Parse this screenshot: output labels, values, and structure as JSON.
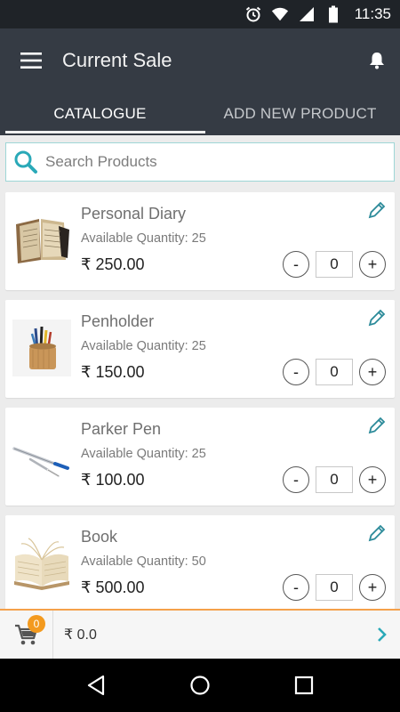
{
  "status_bar": {
    "time": "11:35",
    "icons": [
      "alarm-icon",
      "wifi-icon",
      "signal-icon",
      "battery-icon"
    ]
  },
  "app_bar": {
    "title": "Current Sale",
    "menu_icon": "hamburger-menu-icon",
    "notification_icon": "bell-icon"
  },
  "tabs": [
    {
      "label": "CATALOGUE",
      "active": true
    },
    {
      "label": "ADD NEW PRODUCT",
      "active": false
    }
  ],
  "search": {
    "placeholder": "Search Products",
    "value": ""
  },
  "products": [
    {
      "name": "Personal Diary",
      "availability": "Available Quantity: 25",
      "price": "₹ 250.00",
      "qty": "0",
      "image": "diary"
    },
    {
      "name": "Penholder",
      "availability": "Available Quantity: 25",
      "price": "₹ 150.00",
      "qty": "0",
      "image": "penholder"
    },
    {
      "name": "Parker Pen",
      "availability": "Available Quantity: 25",
      "price": "₹ 100.00",
      "qty": "0",
      "image": "pen"
    },
    {
      "name": "Book",
      "availability": "Available Quantity: 50",
      "price": "₹ 500.00",
      "qty": "0",
      "image": "book"
    }
  ],
  "qty_controls": {
    "minus": "-",
    "plus": "+"
  },
  "cart": {
    "count": "0",
    "total": "₹ 0.0"
  },
  "colors": {
    "app_bar": "#353b44",
    "status_bar": "#1f2328",
    "accent": "#2aa9b8",
    "badge": "#f39a1f"
  }
}
